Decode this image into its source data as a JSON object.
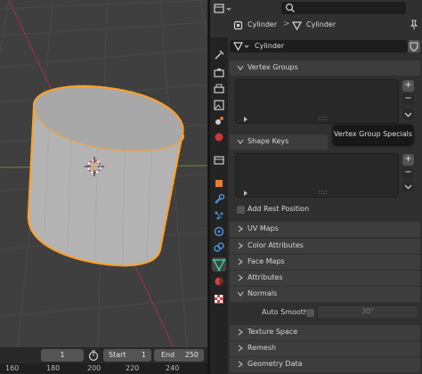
{
  "header": {
    "breadcrumb_object": "Cylinder",
    "breadcrumb_data": "Cylinder",
    "search_placeholder": "",
    "data_name_value": "Cylinder"
  },
  "sections": {
    "vertex_groups": "Vertex Groups",
    "shape_keys": "Shape Keys",
    "add_rest_position": "Add Rest Position",
    "uv_maps": "UV Maps",
    "color_attributes": "Color Attributes",
    "face_maps": "Face Maps",
    "attributes": "Attributes",
    "normals": "Normals",
    "auto_smooth": "Auto Smooth",
    "auto_smooth_angle": "30°",
    "texture_space": "Texture Space",
    "remesh": "Remesh",
    "geometry_data": "Geometry Data"
  },
  "tooltip": "Vertex Group Specials",
  "timeline": {
    "current_frame": "1",
    "start_label": "Start",
    "start_value": "1",
    "end_label": "End",
    "end_value": "250"
  },
  "ruler": [
    "160",
    "180",
    "200",
    "220",
    "240"
  ],
  "colors": {
    "accent_selected": "#ffa028",
    "viewport_bg": "#3f3f3f",
    "panel_bg": "#303030"
  }
}
